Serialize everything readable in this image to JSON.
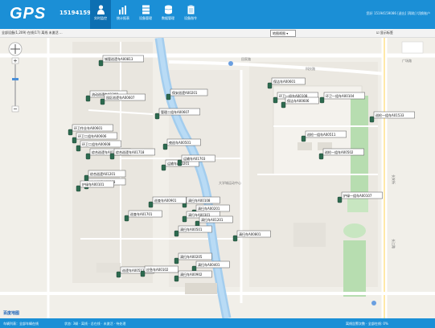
{
  "header": {
    "logo": "GPS",
    "account": "15194159086",
    "tabs": [
      {
        "label": "实时监控",
        "icon": "person-icon"
      },
      {
        "label": "统计报表",
        "icon": "bar-chart-icon"
      },
      {
        "label": "设备管理",
        "icon": "server-icon"
      },
      {
        "label": "数据管理",
        "icon": "database-icon"
      },
      {
        "label": "设备指令",
        "icon": "clipboard-icon"
      }
    ],
    "right_text": "您好 15194159086 [退出] [帮助] 切换账户"
  },
  "toolbar": {
    "breadcrumb": "全部设备(1,209) 在线(17) 离线 未激活 ...",
    "view_select": "地图视图",
    "checkbox_label": "显示标签"
  },
  "map": {
    "road_labels": [
      "田家路",
      "科技路",
      "长安街",
      "长江路",
      "广场路"
    ],
    "campus_label": "大学城运动中心",
    "vehicles": [
      {
        "label": "城管巡逻车A00813"
      },
      {
        "label": "流动巡逻车A1308"
      },
      {
        "label": "环卫作业车A00601"
      },
      {
        "label": "园区巡逻车A00607"
      },
      {
        "label": "保安巡逻A00201"
      },
      {
        "label": "环卫二组车A00606"
      },
      {
        "label": "环卫二组车A00608"
      },
      {
        "label": "综合巡逻车A01701"
      },
      {
        "label": "综合巡逻车A01718"
      },
      {
        "label": "夜巡车A00501"
      },
      {
        "label": "综合巡逻A01201"
      },
      {
        "label": "综合巡逻A01203"
      },
      {
        "label": "巡逻车A00512"
      },
      {
        "label": "管理二组车A00607"
      },
      {
        "label": "环卫一组车A00104"
      },
      {
        "label": "环卫一组车A00108"
      },
      {
        "label": "巡检一组车A01533"
      },
      {
        "label": "巡检一组车A00511"
      },
      {
        "label": "巡检一组车A00502"
      },
      {
        "label": "护绿一组车A00107"
      },
      {
        "label": "运输车A00201"
      },
      {
        "label": "运输车A01703"
      },
      {
        "label": "清扫车A00108"
      },
      {
        "label": "清扫车A00201"
      },
      {
        "label": "清扫车A00301"
      },
      {
        "label": "清扫车A01201"
      },
      {
        "label": "清扫车A00501"
      },
      {
        "label": "清扫车A00801"
      },
      {
        "label": "清扫车A00205"
      },
      {
        "label": "清扫车A00401"
      },
      {
        "label": "清扫车A00902"
      },
      {
        "label": "巡查车A01701"
      },
      {
        "label": "巡查车A00901"
      },
      {
        "label": "应急车A00102"
      },
      {
        "label": "护绿车A00101"
      },
      {
        "label": "保洁车A00601"
      },
      {
        "label": "保洁车A00606"
      }
    ]
  },
  "status": {
    "left": "车辆列表：全部车辆在线",
    "middle": "状态: 3辆 · 离线 · 总在线 · 未激活 · 待处理",
    "right": "离线告警次数 · 全部在线: 0%"
  },
  "bottom_brand": "百度地图"
}
